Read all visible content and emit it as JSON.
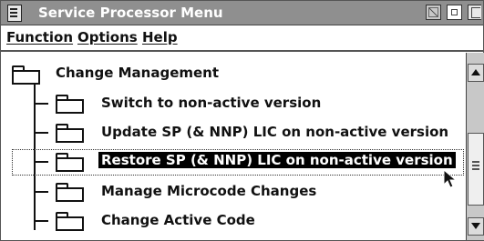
{
  "window": {
    "title": "Service Processor Menu"
  },
  "menubar": {
    "items": [
      "Function",
      "Options",
      "Help"
    ]
  },
  "tree": {
    "root": {
      "label": "Change Management",
      "icon": "folder-icon"
    },
    "children": [
      {
        "label": "Switch to non-active version",
        "selected": false
      },
      {
        "label": "Update SP (& NNP) LIC on non-active version",
        "selected": false
      },
      {
        "label": "Restore SP (& NNP) LIC on non-active version",
        "selected": true
      },
      {
        "label": "Manage Microcode Changes",
        "selected": false
      },
      {
        "label": "Change Active Code",
        "selected": false
      }
    ]
  },
  "colors": {
    "titlebar": "#8f8f8f",
    "selection_bg": "#000000",
    "selection_fg": "#ffffff"
  }
}
